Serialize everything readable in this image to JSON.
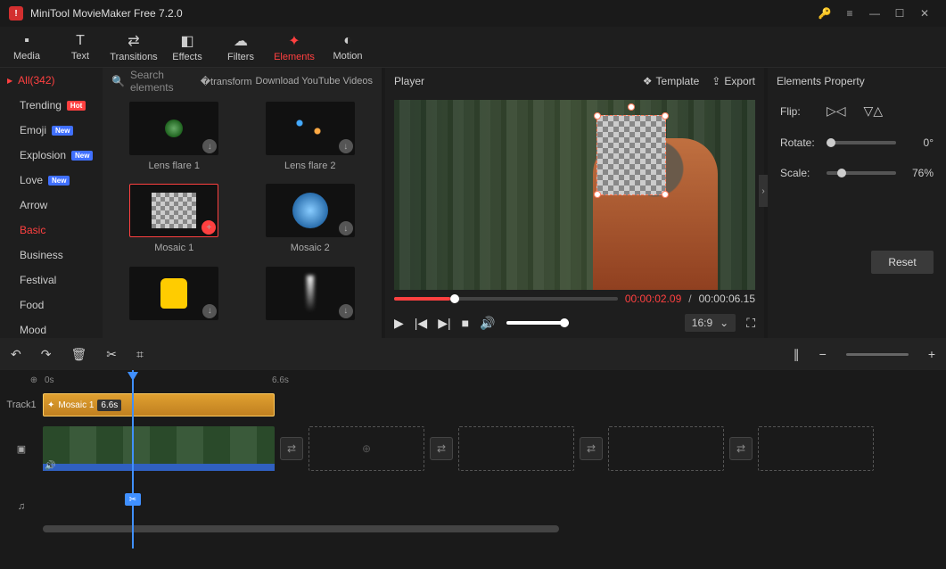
{
  "app": {
    "title": "MiniTool MovieMaker Free 7.2.0"
  },
  "tabs": [
    {
      "label": "Media"
    },
    {
      "label": "Text"
    },
    {
      "label": "Transitions"
    },
    {
      "label": "Effects"
    },
    {
      "label": "Filters"
    },
    {
      "label": "Elements"
    },
    {
      "label": "Motion"
    }
  ],
  "sidebar": {
    "all_label": "All(342)",
    "items": [
      {
        "label": "Trending",
        "badge": "Hot"
      },
      {
        "label": "Emoji",
        "badge": "New"
      },
      {
        "label": "Explosion",
        "badge": "New"
      },
      {
        "label": "Love",
        "badge": "New"
      },
      {
        "label": "Arrow",
        "badge": null
      },
      {
        "label": "Basic",
        "badge": null
      },
      {
        "label": "Business",
        "badge": null
      },
      {
        "label": "Festival",
        "badge": null
      },
      {
        "label": "Food",
        "badge": null
      },
      {
        "label": "Mood",
        "badge": null
      }
    ]
  },
  "grid": {
    "search_placeholder": "Search elements",
    "download_label": "Download YouTube Videos",
    "items": [
      {
        "label": "Lens flare 1"
      },
      {
        "label": "Lens flare 2"
      },
      {
        "label": "Mosaic 1"
      },
      {
        "label": "Mosaic 2"
      },
      {
        "label": ""
      },
      {
        "label": ""
      }
    ]
  },
  "player": {
    "title": "Player",
    "template_label": "Template",
    "export_label": "Export",
    "current_time": "00:00:02.09",
    "total_time": "00:00:06.15",
    "aspect": "16:9"
  },
  "props": {
    "title": "Elements Property",
    "flip_label": "Flip:",
    "rotate_label": "Rotate:",
    "rotate_value": "0°",
    "scale_label": "Scale:",
    "scale_value": "76%",
    "reset_label": "Reset"
  },
  "timeline": {
    "ruler": {
      "t0": "0s",
      "t1": "6.6s"
    },
    "track1_label": "Track1",
    "effect_clip": {
      "name": "Mosaic 1",
      "duration": "6.6s"
    }
  }
}
